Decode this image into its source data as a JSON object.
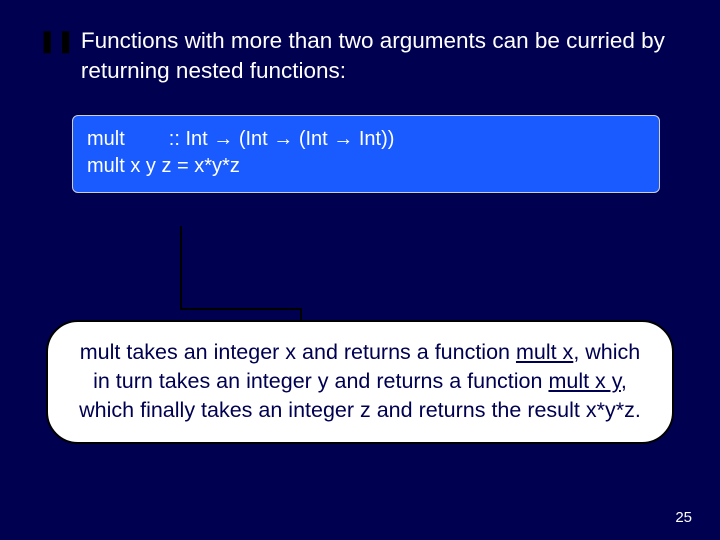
{
  "bullet": {
    "icon": "❚❚",
    "text": "Functions with more than two arguments can be curried by returning nested functions:"
  },
  "code": {
    "line1_a": "mult",
    "line1_b": ":: Int → (Int → (Int → Int))",
    "line2": "mult x y z = x*y*z"
  },
  "explain": {
    "p1": "mult takes an integer x and returns a function ",
    "u1": "mult x",
    "p2": ", which in turn takes an integer y and returns a function ",
    "u2": "mult x y",
    "p3": ", which finally takes an integer z and returns the result x*y*z."
  },
  "pageNumber": "25"
}
